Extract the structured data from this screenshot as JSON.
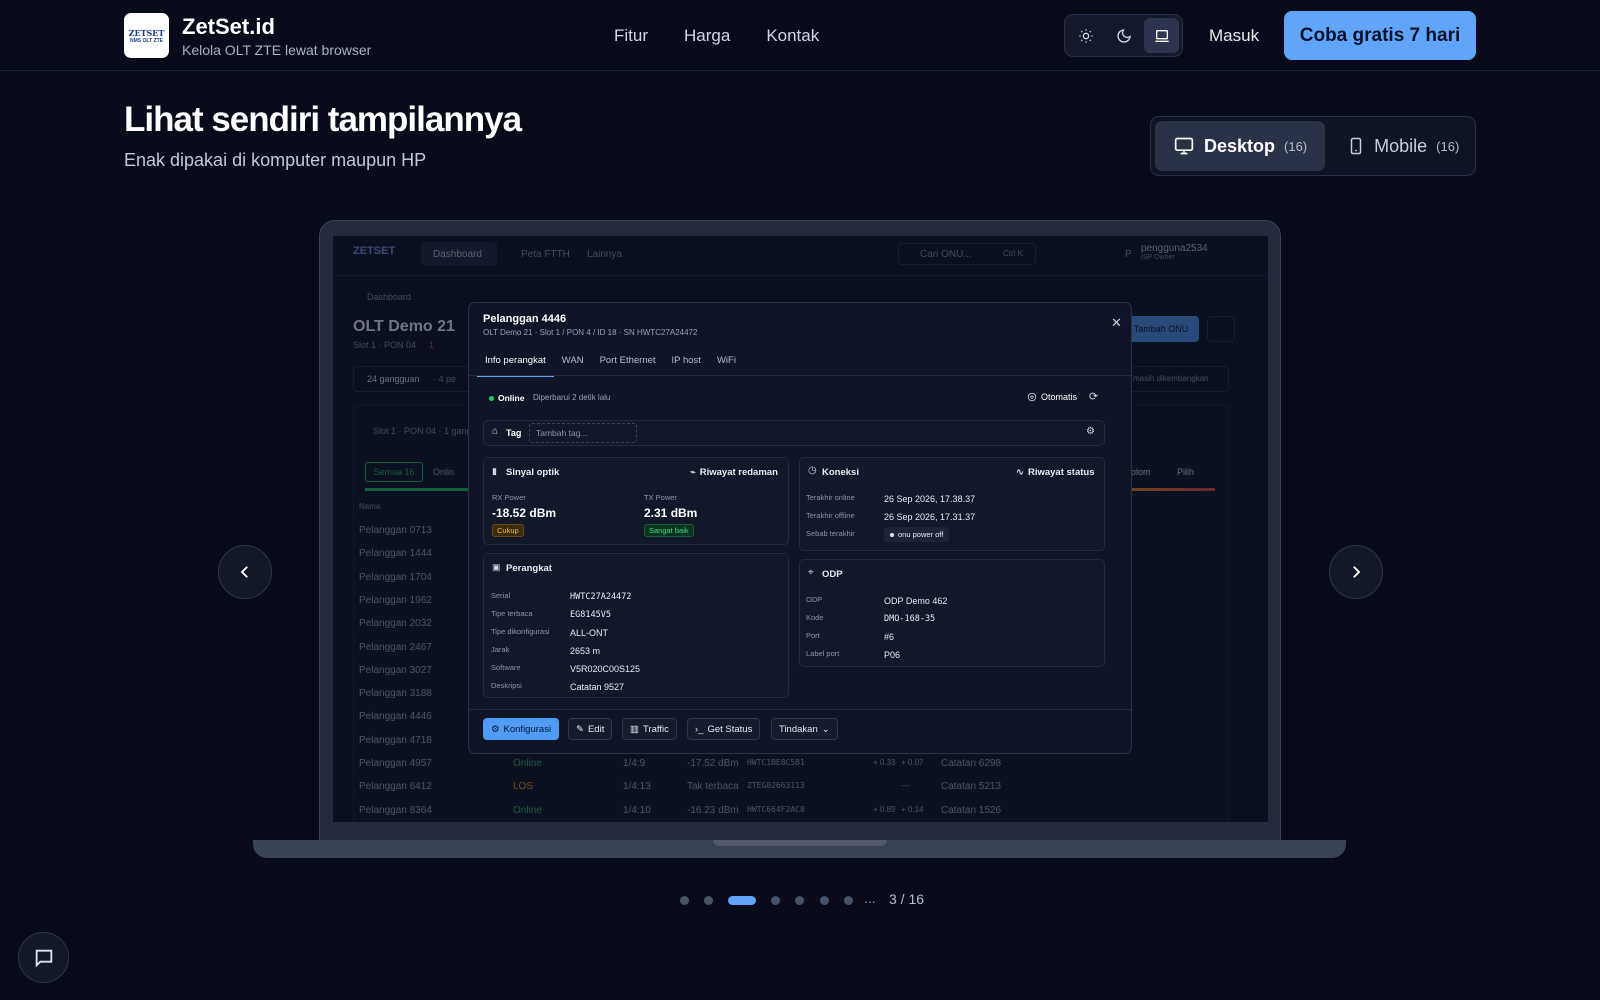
{
  "header": {
    "logo_text": "ZETSET",
    "logo_sub": "NMS OLT ZTE",
    "brand": "ZetSet.id",
    "tagline": "Kelola OLT ZTE lewat browser",
    "nav": [
      "Fitur",
      "Harga",
      "Kontak"
    ],
    "theme_options": [
      "sun-icon",
      "moon-icon",
      "laptop-icon"
    ],
    "login": "Masuk",
    "cta": "Coba gratis 7 hari",
    "accent": "#60a5fa"
  },
  "hero": {
    "title": "Lihat sendiri tampilannya",
    "subtitle": "Enak dipakai di komputer maupun HP",
    "toggle": [
      {
        "label": "Desktop",
        "count": "(16)",
        "icon": "monitor-icon"
      },
      {
        "label": "Mobile",
        "count": "(16)",
        "icon": "phone-icon"
      }
    ]
  },
  "pager": {
    "text": "3 / 16",
    "ellipsis": "...",
    "active_index": 2
  },
  "app": {
    "nav": {
      "dashboard": "Dashboard",
      "peta": "Peta FTTH",
      "lainnya": "Lainnya",
      "search": "Cari ONU...",
      "shortcut": "Ctrl K",
      "user": "pengguna2534",
      "role": "ISP Owner",
      "avatar": "P"
    },
    "breadcrumb": "Dashboard",
    "olt_title": "OLT Demo 21",
    "olt_sub": "Slot 1 · PON 04",
    "olt_badge": "1",
    "add_onu": "Tambah ONU",
    "alert": "24 gangguan",
    "alert_sub": "· 4 pe",
    "alert_right": "masih dikembangkan",
    "slot_line": "Slot 1 · PON 04 · 1 gang",
    "filter_all": "Semua 16",
    "filter_online": "Onlin",
    "kolom": "Kolom",
    "pilih": "Pilih",
    "col_name": "Nama",
    "rows": [
      "Pelanggan 0713",
      "Pelanggan 1444",
      "Pelanggan 1704",
      "Pelanggan 1962",
      "Pelanggan 2032",
      "Pelanggan 2467",
      "Pelanggan 3027",
      "Pelanggan 3188",
      "Pelanggan 4446",
      "Pelanggan 4718",
      "Pelanggan 4957",
      "Pelanggan 6412",
      "Pelanggan 8364"
    ],
    "row_details": [
      {
        "status": "Online",
        "port": "1/4:9",
        "rx": "-17.52 dBm",
        "sn": "HWTC1BE8C581",
        "d1": "+ 0.33",
        "d2": "+ 0.07",
        "note": "Catatan 6298",
        "color": "#22c55e"
      },
      {
        "status": "LOS",
        "port": "1/4:13",
        "rx": "Tak terbaca",
        "sn": "ZTEG02663113",
        "d1": "",
        "d2": "—",
        "note": "Catatan 5213",
        "color": "#f59e0b"
      },
      {
        "status": "Online",
        "port": "1/4:10",
        "rx": "-16.23 dBm",
        "sn": "HWTC664F2AC8",
        "d1": "+ 0.89",
        "d2": "+ 0.14",
        "note": "Catatan 1526",
        "color": "#22c55e"
      }
    ]
  },
  "modal": {
    "title": "Pelanggan 4446",
    "subtitle": "OLT Demo 21 · Slot 1 / PON 4 / ID 18 · SN HWTC27A24472",
    "tabs": [
      "Info perangkat",
      "WAN",
      "Port Ethernet",
      "IP host",
      "WiFi"
    ],
    "status": "Online",
    "updated": "Diperbarui 2 detik lalu",
    "auto": "Otomatis",
    "tag_label": "Tag",
    "tag_placeholder": "Tambah tag...",
    "optik": {
      "title": "Sinyal optik",
      "history": "Riwayat redaman",
      "rx_label": "RX Power",
      "rx_value": "-18.52 dBm",
      "rx_badge": "Cukup",
      "tx_label": "TX Power",
      "tx_value": "2.31 dBm",
      "tx_badge": "Sangat baik"
    },
    "koneksi": {
      "title": "Koneksi",
      "history": "Riwayat status",
      "rows": [
        {
          "label": "Terakhir online",
          "value": "26 Sep 2026, 17.38.37"
        },
        {
          "label": "Terakhir offline",
          "value": "26 Sep 2026, 17.31.37"
        },
        {
          "label": "Sebab terakhir",
          "value": "onu power off"
        }
      ]
    },
    "perangkat": {
      "title": "Perangkat",
      "rows": [
        {
          "label": "Serial",
          "value": "HWTC27A24472"
        },
        {
          "label": "Tipe terbaca",
          "value": "EG8145V5"
        },
        {
          "label": "Tipe dikonfigurasi",
          "value": "ALL-ONT"
        },
        {
          "label": "Jarak",
          "value": "2653 m"
        },
        {
          "label": "Software",
          "value": "V5R020C00S125"
        },
        {
          "label": "Deskripsi",
          "value": "Catatan 9527"
        }
      ]
    },
    "odp": {
      "title": "ODP",
      "rows": [
        {
          "label": "ODP",
          "value": "ODP Demo 462"
        },
        {
          "label": "Kode",
          "value": "DMO-168-35"
        },
        {
          "label": "Port",
          "value": "#6"
        },
        {
          "label": "Label port",
          "value": "P06"
        }
      ]
    },
    "actions": [
      "Konfigurasi",
      "Edit",
      "Traffic",
      "Get Status",
      "Tindakan"
    ]
  }
}
